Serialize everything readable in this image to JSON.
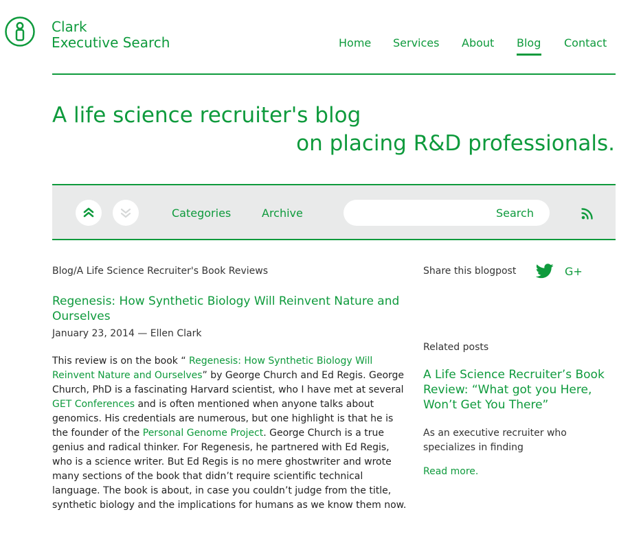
{
  "brand": {
    "line1": "Clark",
    "line2": "Executive Search",
    "accent_color": "#0e9a3c",
    "toolbar_color": "#e9eaea"
  },
  "nav": {
    "items": [
      "Home",
      "Services",
      "About",
      "Blog",
      "Contact"
    ],
    "active": "Blog"
  },
  "hero": {
    "line1": "A life science recruiter's blog",
    "line2": "on placing R&D professionals."
  },
  "toolbar": {
    "up_icon": "chevron-double-up-icon",
    "down_icon": "chevron-double-down-icon",
    "categories": "Categories",
    "archive": "Archive",
    "search_button": "Search",
    "search_value": "",
    "rss_icon": "rss-icon"
  },
  "post": {
    "breadcrumb": "Blog/A Life Science Recruiter's Book Reviews",
    "title": "Regenesis: How Synthetic Biology Will Reinvent Nature and Ourselves",
    "meta": "January 23, 2014 — Ellen Clark",
    "body": {
      "t1": "This review is on the book “ ",
      "link1": "Regenesis: How Synthetic Biology Will Reinvent Nature and Ourselves",
      "t2": "” by George Church and Ed Regis. George Church, PhD is a fascinating Harvard scientist, who I have met at several ",
      "link2": "GET Conferences",
      "t3": "  and is often mentioned when anyone talks about genomics. His credentials are numerous, but one highlight is that he is the founder of the ",
      "link3": "Personal Genome Project",
      "t4": ". George Church is a true genius and radical thinker. For Regenesis, he partnered with Ed Regis, who is a science writer. But Ed Regis is no mere ghostwriter and wrote many sections of the book that didn’t require scientific technical language. The book is about, in case you couldn’t judge from the title, synthetic biology and the implications for humans as we know them now."
    }
  },
  "sidebar": {
    "share_label": "Share this blogpost",
    "twitter_icon": "twitter-icon",
    "gplus": "G+",
    "related_label": "Related posts",
    "related_title": "A Life Science Recruiter’s Book Review: “What got you Here, Won’t Get You There”",
    "related_excerpt": "As an executive recruiter who specializes in finding",
    "read_more": "Read more."
  }
}
